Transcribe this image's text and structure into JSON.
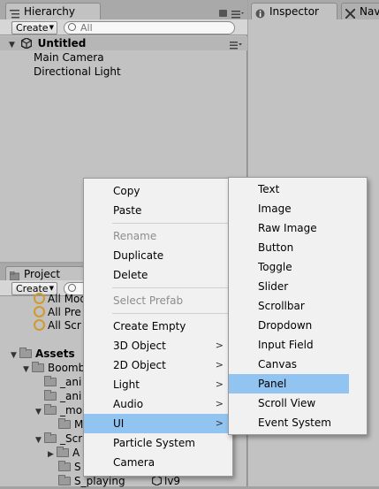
{
  "hierarchy": {
    "tab_label": "Hierarchy",
    "create_label": "Create",
    "search_placeholder": "All",
    "scene_name": "Untitled",
    "items": [
      "Main Camera",
      "Directional Light"
    ]
  },
  "inspector": {
    "tab_label": "Inspector",
    "nav_tab_label": "Nav"
  },
  "project": {
    "tab_label": "Project",
    "create_label": "Create",
    "favorites": [
      "All Mod",
      "All Pre",
      "All Scr"
    ],
    "assets_label": "Assets",
    "tree": [
      "Boomb",
      "_ani",
      "_ani",
      "_mo",
      "M",
      "_Scr",
      "A",
      "S",
      "S_playing"
    ],
    "side_file": "lv9"
  },
  "context_menu": {
    "items": [
      {
        "label": "Copy",
        "enabled": true
      },
      {
        "label": "Paste",
        "enabled": true
      },
      {
        "label": "Rename",
        "enabled": false
      },
      {
        "label": "Duplicate",
        "enabled": true
      },
      {
        "label": "Delete",
        "enabled": true
      },
      {
        "label": "Select Prefab",
        "enabled": false
      },
      {
        "label": "Create Empty",
        "enabled": true
      },
      {
        "label": "3D Object",
        "enabled": true,
        "submenu": true
      },
      {
        "label": "2D Object",
        "enabled": true,
        "submenu": true
      },
      {
        "label": "Light",
        "enabled": true,
        "submenu": true
      },
      {
        "label": "Audio",
        "enabled": true,
        "submenu": true
      },
      {
        "label": "UI",
        "enabled": true,
        "submenu": true,
        "highlighted": true
      },
      {
        "label": "Particle System",
        "enabled": true
      },
      {
        "label": "Camera",
        "enabled": true
      }
    ]
  },
  "ui_submenu": {
    "items": [
      "Text",
      "Image",
      "Raw Image",
      "Button",
      "Toggle",
      "Slider",
      "Scrollbar",
      "Dropdown",
      "Input Field",
      "Canvas",
      "Panel",
      "Scroll View",
      "Event System"
    ],
    "highlighted": "Panel"
  },
  "colors": {
    "highlight": "#92c4f1",
    "panel": "#c2c2c2",
    "menu": "#f1f1f1"
  }
}
